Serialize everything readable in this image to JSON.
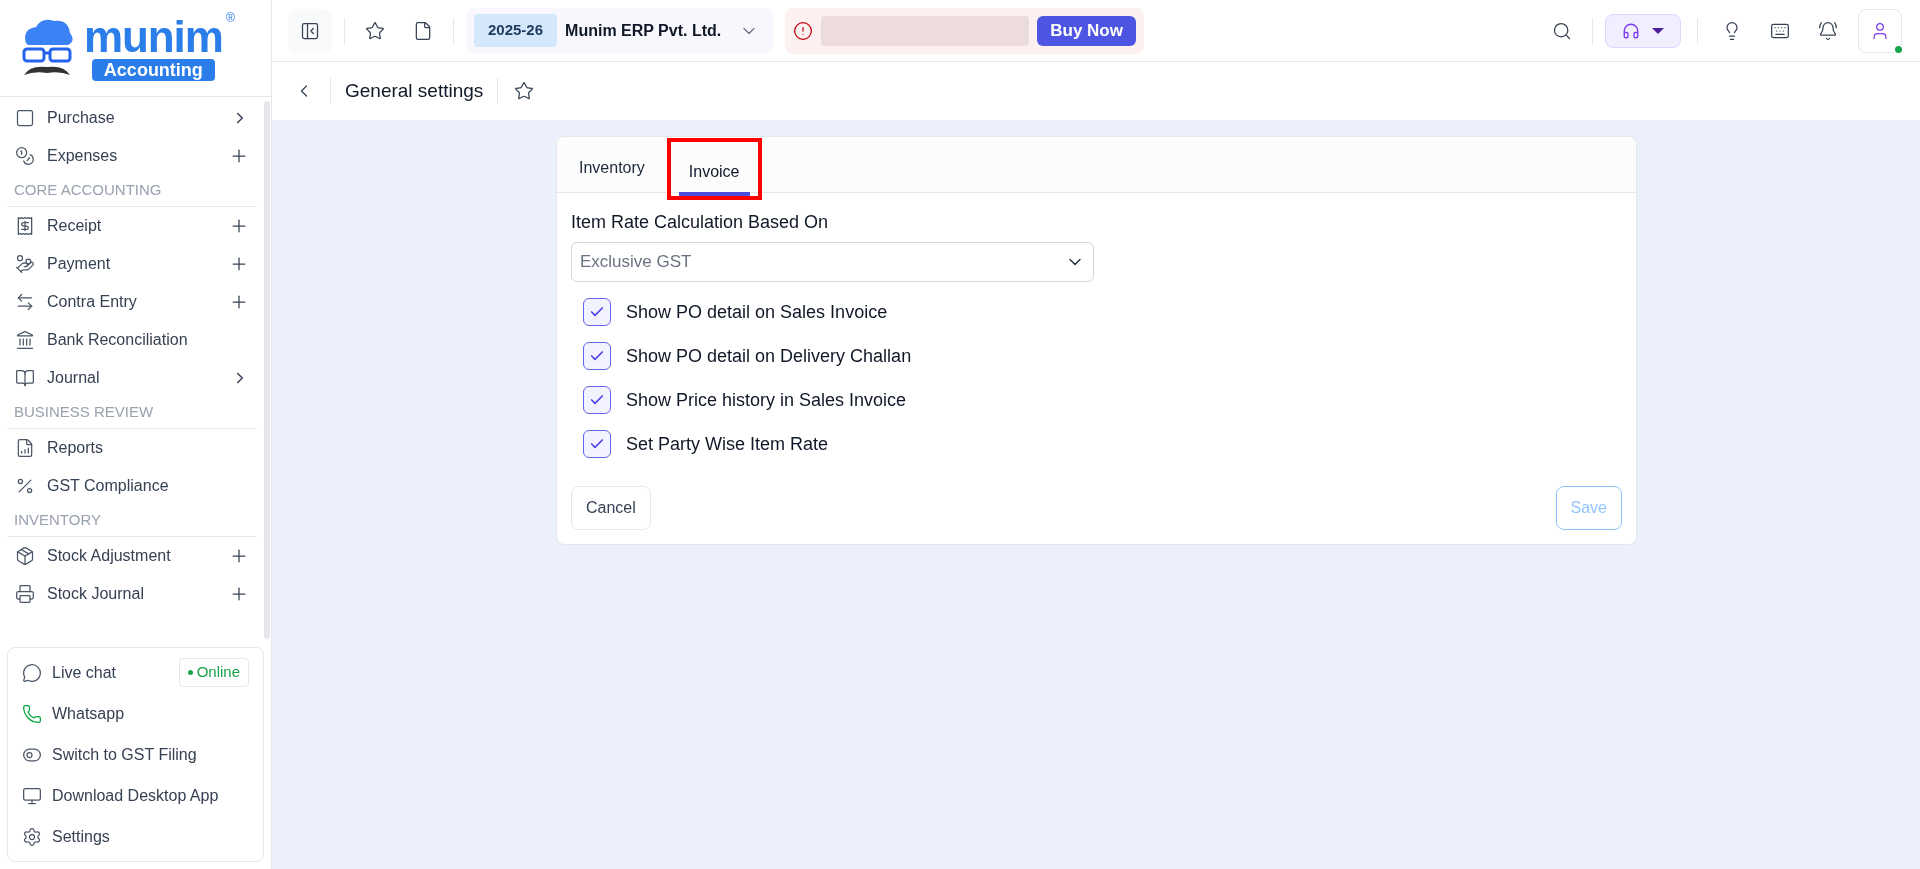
{
  "logo": {
    "word": "munim",
    "badge": "Accounting",
    "mark": "®"
  },
  "sidebar": {
    "sections": [
      {
        "items": [
          {
            "label": "Purchase",
            "kind": "chevron"
          },
          {
            "label": "Expenses",
            "kind": "plus"
          }
        ]
      },
      {
        "heading": "CORE ACCOUNTING",
        "items": [
          {
            "label": "Receipt",
            "kind": "plus"
          },
          {
            "label": "Payment",
            "kind": "plus"
          },
          {
            "label": "Contra Entry",
            "kind": "plus"
          },
          {
            "label": "Bank Reconciliation",
            "kind": "none"
          },
          {
            "label": "Journal",
            "kind": "chevron"
          }
        ]
      },
      {
        "heading": "BUSINESS REVIEW",
        "items": [
          {
            "label": "Reports",
            "kind": "none"
          },
          {
            "label": "GST Compliance",
            "kind": "none"
          }
        ]
      },
      {
        "heading": "INVENTORY",
        "items": [
          {
            "label": "Stock Adjustment",
            "kind": "plus"
          },
          {
            "label": "Stock Journal",
            "kind": "plus"
          }
        ]
      }
    ]
  },
  "help_panel": {
    "items": [
      {
        "label": "Live chat",
        "badge": "Online"
      },
      {
        "label": "Whatsapp"
      },
      {
        "label": "Switch to GST Filing"
      },
      {
        "label": "Download Desktop App"
      },
      {
        "label": "Settings"
      }
    ]
  },
  "topbar": {
    "year": "2025-26",
    "company": "Munim ERP Pvt. Ltd.",
    "buy_button": "Buy Now"
  },
  "page": {
    "title": "General settings"
  },
  "settings_card": {
    "tabs": [
      {
        "label": "Inventory",
        "selected": false,
        "highlighted": false
      },
      {
        "label": "Invoice",
        "selected": true,
        "highlighted": true
      }
    ],
    "field_label": "Item Rate Calculation Based On",
    "select_value": "Exclusive GST",
    "options": [
      {
        "label": "Show PO detail on Sales Invoice",
        "checked": true
      },
      {
        "label": "Show PO detail on Delivery Challan",
        "checked": true
      },
      {
        "label": "Show Price history in Sales Invoice",
        "checked": true
      },
      {
        "label": "Set Party Wise Item Rate",
        "checked": true
      }
    ],
    "cancel_button": "Cancel",
    "save_button": "Save",
    "save_disabled": true
  }
}
